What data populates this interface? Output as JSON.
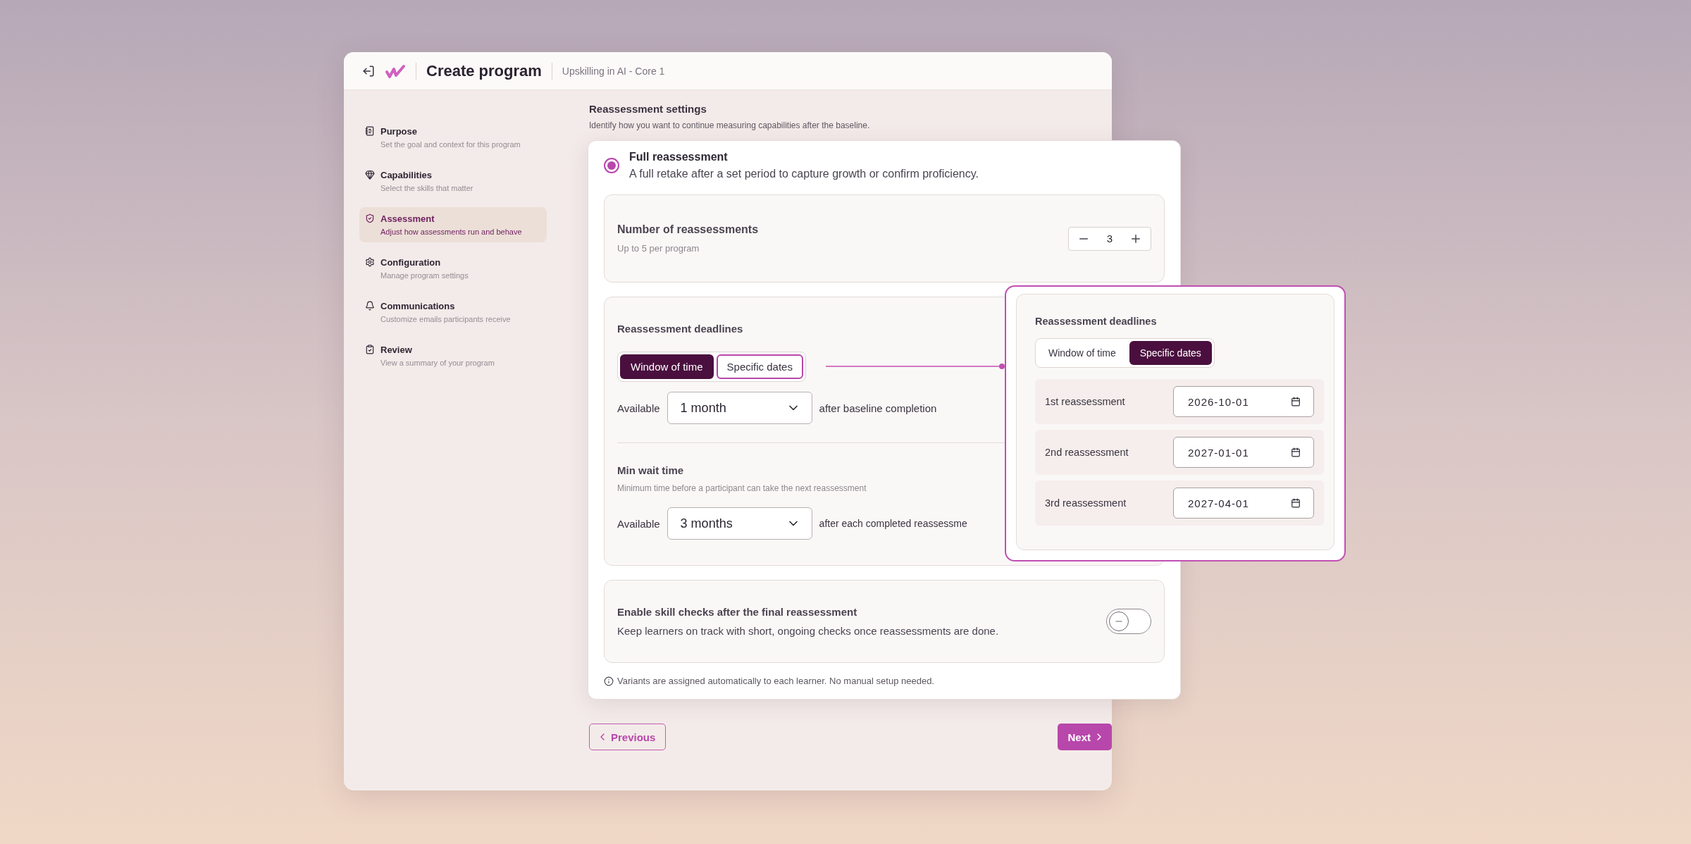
{
  "header": {
    "title": "Create program",
    "subtitle": "Upskilling in AI - Core 1"
  },
  "sidebar": {
    "items": [
      {
        "kind": "purpose",
        "title": "Purpose",
        "description": "Set the goal and context for this program",
        "selected": false
      },
      {
        "kind": "capabilities",
        "title": "Capabilities",
        "description": "Select the skills that matter",
        "selected": false
      },
      {
        "kind": "assessment",
        "title": "Assessment",
        "description": "Adjust how assessments run and behave",
        "selected": true
      },
      {
        "kind": "configuration",
        "title": "Configuration",
        "description": "Manage program settings",
        "selected": false
      },
      {
        "kind": "communications",
        "title": "Communications",
        "description": "Customize emails participants receive",
        "selected": false
      },
      {
        "kind": "review",
        "title": "Review",
        "description": "View a summary of your program",
        "selected": false
      }
    ]
  },
  "section": {
    "title": "Reassessment settings",
    "description": "Identify how you want to continue measuring capabilities after the baseline."
  },
  "option": {
    "title": "Full reassessment",
    "description": "A full retake after a set period to capture growth or confirm proficiency.",
    "selected": true
  },
  "count": {
    "title": "Number of reassessments",
    "hint": "Up to 5 per program",
    "value": "3"
  },
  "deadlines": {
    "title": "Reassessment deadlines",
    "modes": [
      {
        "label": "Window of time",
        "selected": true
      },
      {
        "label": "Specific dates",
        "selected": false
      }
    ],
    "available_label": "Available",
    "duration": "1 month",
    "after_text": "after baseline completion"
  },
  "wait": {
    "title": "Min wait time",
    "description": "Minimum time before a participant can take the next reassessment",
    "available_label": "Available",
    "duration": "3 months",
    "after_text": "after each completed reassessme"
  },
  "skill_checks": {
    "title": "Enable skill checks after the final reassessment",
    "description": "Keep learners on track with short, ongoing checks once reassessments are done.",
    "on": false
  },
  "note": "Variants are assigned automatically to each learner. No manual setup needed.",
  "buttons": {
    "previous": "Previous",
    "next": "Next"
  },
  "callout": {
    "title": "Reassessment deadlines",
    "modes": [
      {
        "label": "Window of time",
        "selected": false
      },
      {
        "label": "Specific dates",
        "selected": true
      }
    ],
    "dates": [
      {
        "label": "1st reassessment",
        "value": "2026-10-01"
      },
      {
        "label": "2nd reassessment",
        "value": "2027-01-01"
      },
      {
        "label": "3rd reassessment",
        "value": "2027-04-01"
      }
    ]
  }
}
